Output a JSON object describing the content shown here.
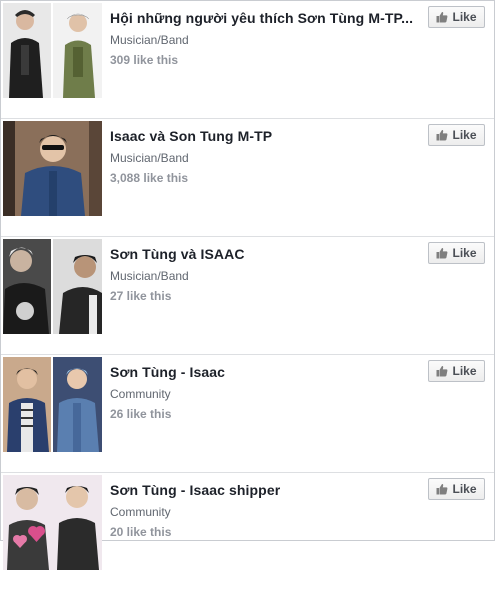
{
  "pages": [
    {
      "title": "Hội những người yêu thích Sơn Tùng M-TP...",
      "category": "Musician/Band",
      "likes": "309 like this",
      "button": "Like",
      "thumb_icon": "page-photo"
    },
    {
      "title": "Isaac và Son Tung M-TP",
      "category": "Musician/Band",
      "likes": "3,088 like this",
      "button": "Like",
      "thumb_icon": "page-photo"
    },
    {
      "title": "Sơn Tùng và ISAAC",
      "category": "Musician/Band",
      "likes": "27 like this",
      "button": "Like",
      "thumb_icon": "page-photo"
    },
    {
      "title": "Sơn Tùng - Isaac",
      "category": "Community",
      "likes": "26 like this",
      "button": "Like",
      "thumb_icon": "page-photo"
    },
    {
      "title": "Sơn Tùng - Isaac shipper",
      "category": "Community",
      "likes": "20 like this",
      "button": "Like",
      "thumb_icon": "page-photo"
    }
  ],
  "colors": {
    "title": "#1d2129",
    "meta": "#616770",
    "likes": "#90949c",
    "button_border": "#bdc1c7"
  }
}
